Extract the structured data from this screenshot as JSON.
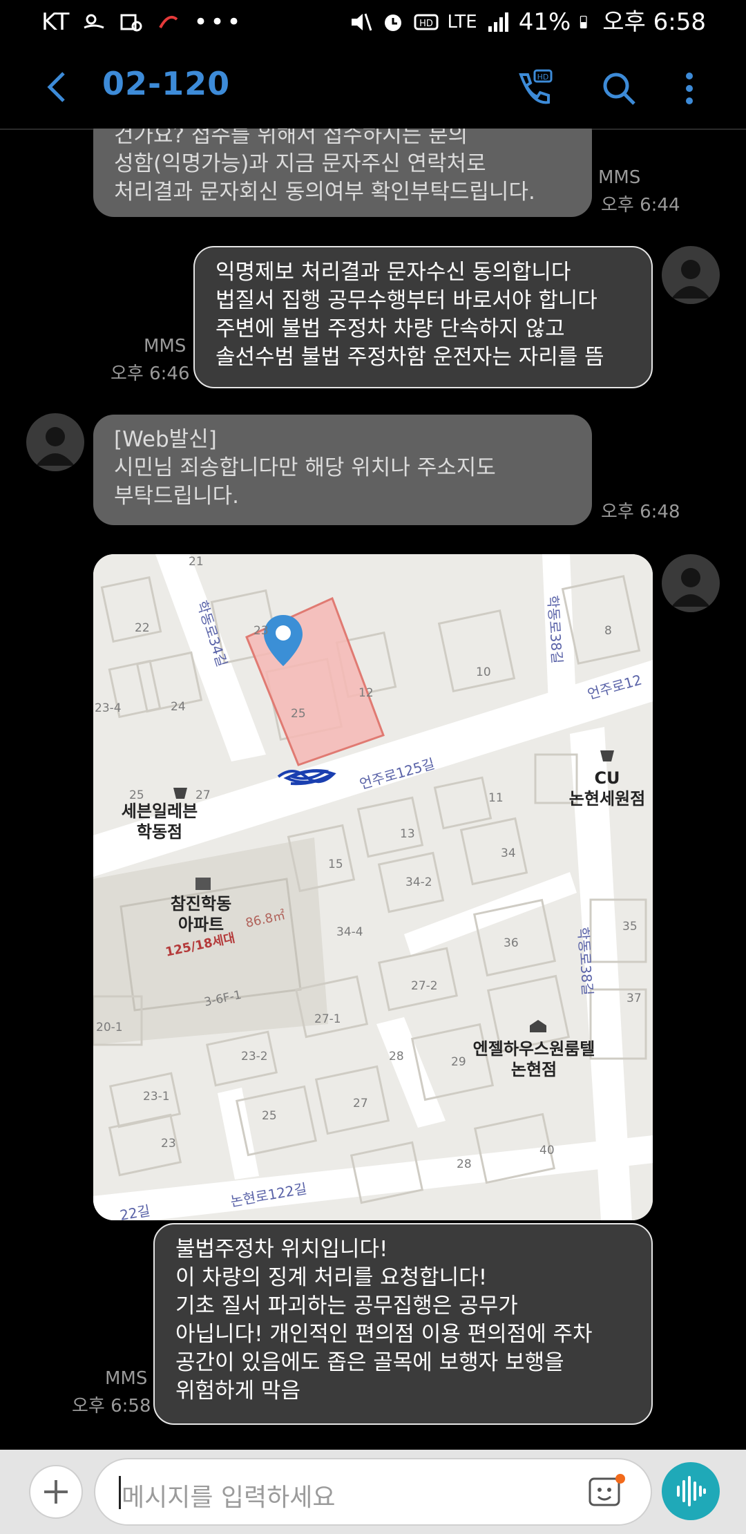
{
  "status": {
    "carrier": "KT",
    "network": "LTE",
    "battery": "41%",
    "time": "오후 6:58"
  },
  "header": {
    "title": "02-120"
  },
  "messages": [
    {
      "dir": "in",
      "text": "건가요? 접수를 위해서 접수하시는 분의\n성함(익명가능)과 지금 문자주신 연락처로\n처리결과 문자회신 동의여부 확인부탁드립니다.",
      "type": "MMS",
      "time": "오후 6:44"
    },
    {
      "dir": "out",
      "text": "익명제보 처리결과 문자수신 동의합니다\n법질서 집행 공무수행부터 바로서야 합니다\n주변에 불법 주정차 차량 단속하지 않고\n솔선수범 불법 주정차함 운전자는 자리를 뜸",
      "type": "MMS",
      "time": "오후 6:46"
    },
    {
      "dir": "in",
      "text": "[Web발신]\n시민님 죄송합니다만 해당 위치나 주소지도\n부탁드립니다.",
      "time": "오후 6:48"
    },
    {
      "dir": "out",
      "text": "불법주정차 위치입니다!\n이 차량의 징계 처리를 요청합니다!\n기초 질서 파괴하는 공무집행은 공무가\n아닙니다! 개인적인 편의점 이용 편의점에 주차\n공간이 있음에도 좁은 골목에 보행자 보행을\n위험하게 막음",
      "type": "MMS",
      "time": "오후 6:58"
    }
  ],
  "map": {
    "places": [
      {
        "name": "세븐일레븐\n학동점"
      },
      {
        "name": "CU\n논현세원점"
      },
      {
        "name": "참진학동\n아파트"
      },
      {
        "name": "엔젤하우스원룸텔\n논현점"
      }
    ],
    "roads": [
      "학동로34길",
      "학동로38길",
      "언주로12",
      "언주로125길",
      "학동로38길",
      "논현로122길",
      "22길"
    ],
    "lots": [
      "21",
      "22",
      "23",
      "23-4",
      "24",
      "25",
      "25",
      "27",
      "12",
      "10",
      "8",
      "11",
      "13",
      "15",
      "34-2",
      "34",
      "34-4",
      "35",
      "36",
      "37",
      "27-2",
      "27-1",
      "28",
      "29",
      "20-1",
      "23-2",
      "23-1",
      "23",
      "25",
      "27",
      "28",
      "40",
      "3-6F-1"
    ],
    "apt_area": "86.8㎡",
    "apt_units": "125/18세대",
    "colors": {
      "highlight": "#f6b9b5",
      "pin": "#3b8fd6",
      "scribble": "#1a3fb0"
    }
  },
  "input": {
    "placeholder": "메시지를 입력하세요"
  },
  "colors": {
    "accent": "#3d8bd8",
    "incoming": "#616161",
    "outgoing": "#3b3b3b",
    "voice": "#1fa9b8"
  }
}
